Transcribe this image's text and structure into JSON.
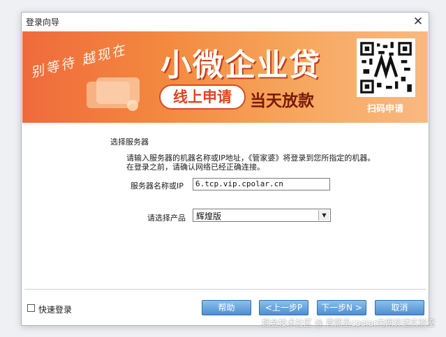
{
  "window": {
    "title": "登录向导",
    "close_glyph": "✕"
  },
  "banner": {
    "slogan": "别等待 越现在",
    "main_title": "小微企业贷",
    "apply_label": "线上申请",
    "sameday_label": "当天放款",
    "qr_label": "扫码申请",
    "colors": {
      "gradient_start": "#f06a3c",
      "gradient_end": "#f8b981",
      "accent_red": "#e0451f"
    }
  },
  "content": {
    "section_title": "选择服务器",
    "description_line1": "请输入服务器的机器名称或IP地址，《管家婆》将登录到您所指定的机器。",
    "description_line2": "在登录之前，请确认网络已经正确连接。",
    "server_label": "服务器名称或IP",
    "server_value": "6.tcp.vip.cpolar.cn",
    "product_label": "请选择产品",
    "product_value": "辉煌版"
  },
  "footer": {
    "quick_login_label": "快速登录",
    "quick_login_checked": false,
    "help_label": "帮助",
    "prev_label": "<上一步P",
    "next_label": "下一步N >",
    "cancel_label": "取消"
  },
  "watermark": "掘金技术社区 @ 青熙丞cpolar内网穿透实验室"
}
